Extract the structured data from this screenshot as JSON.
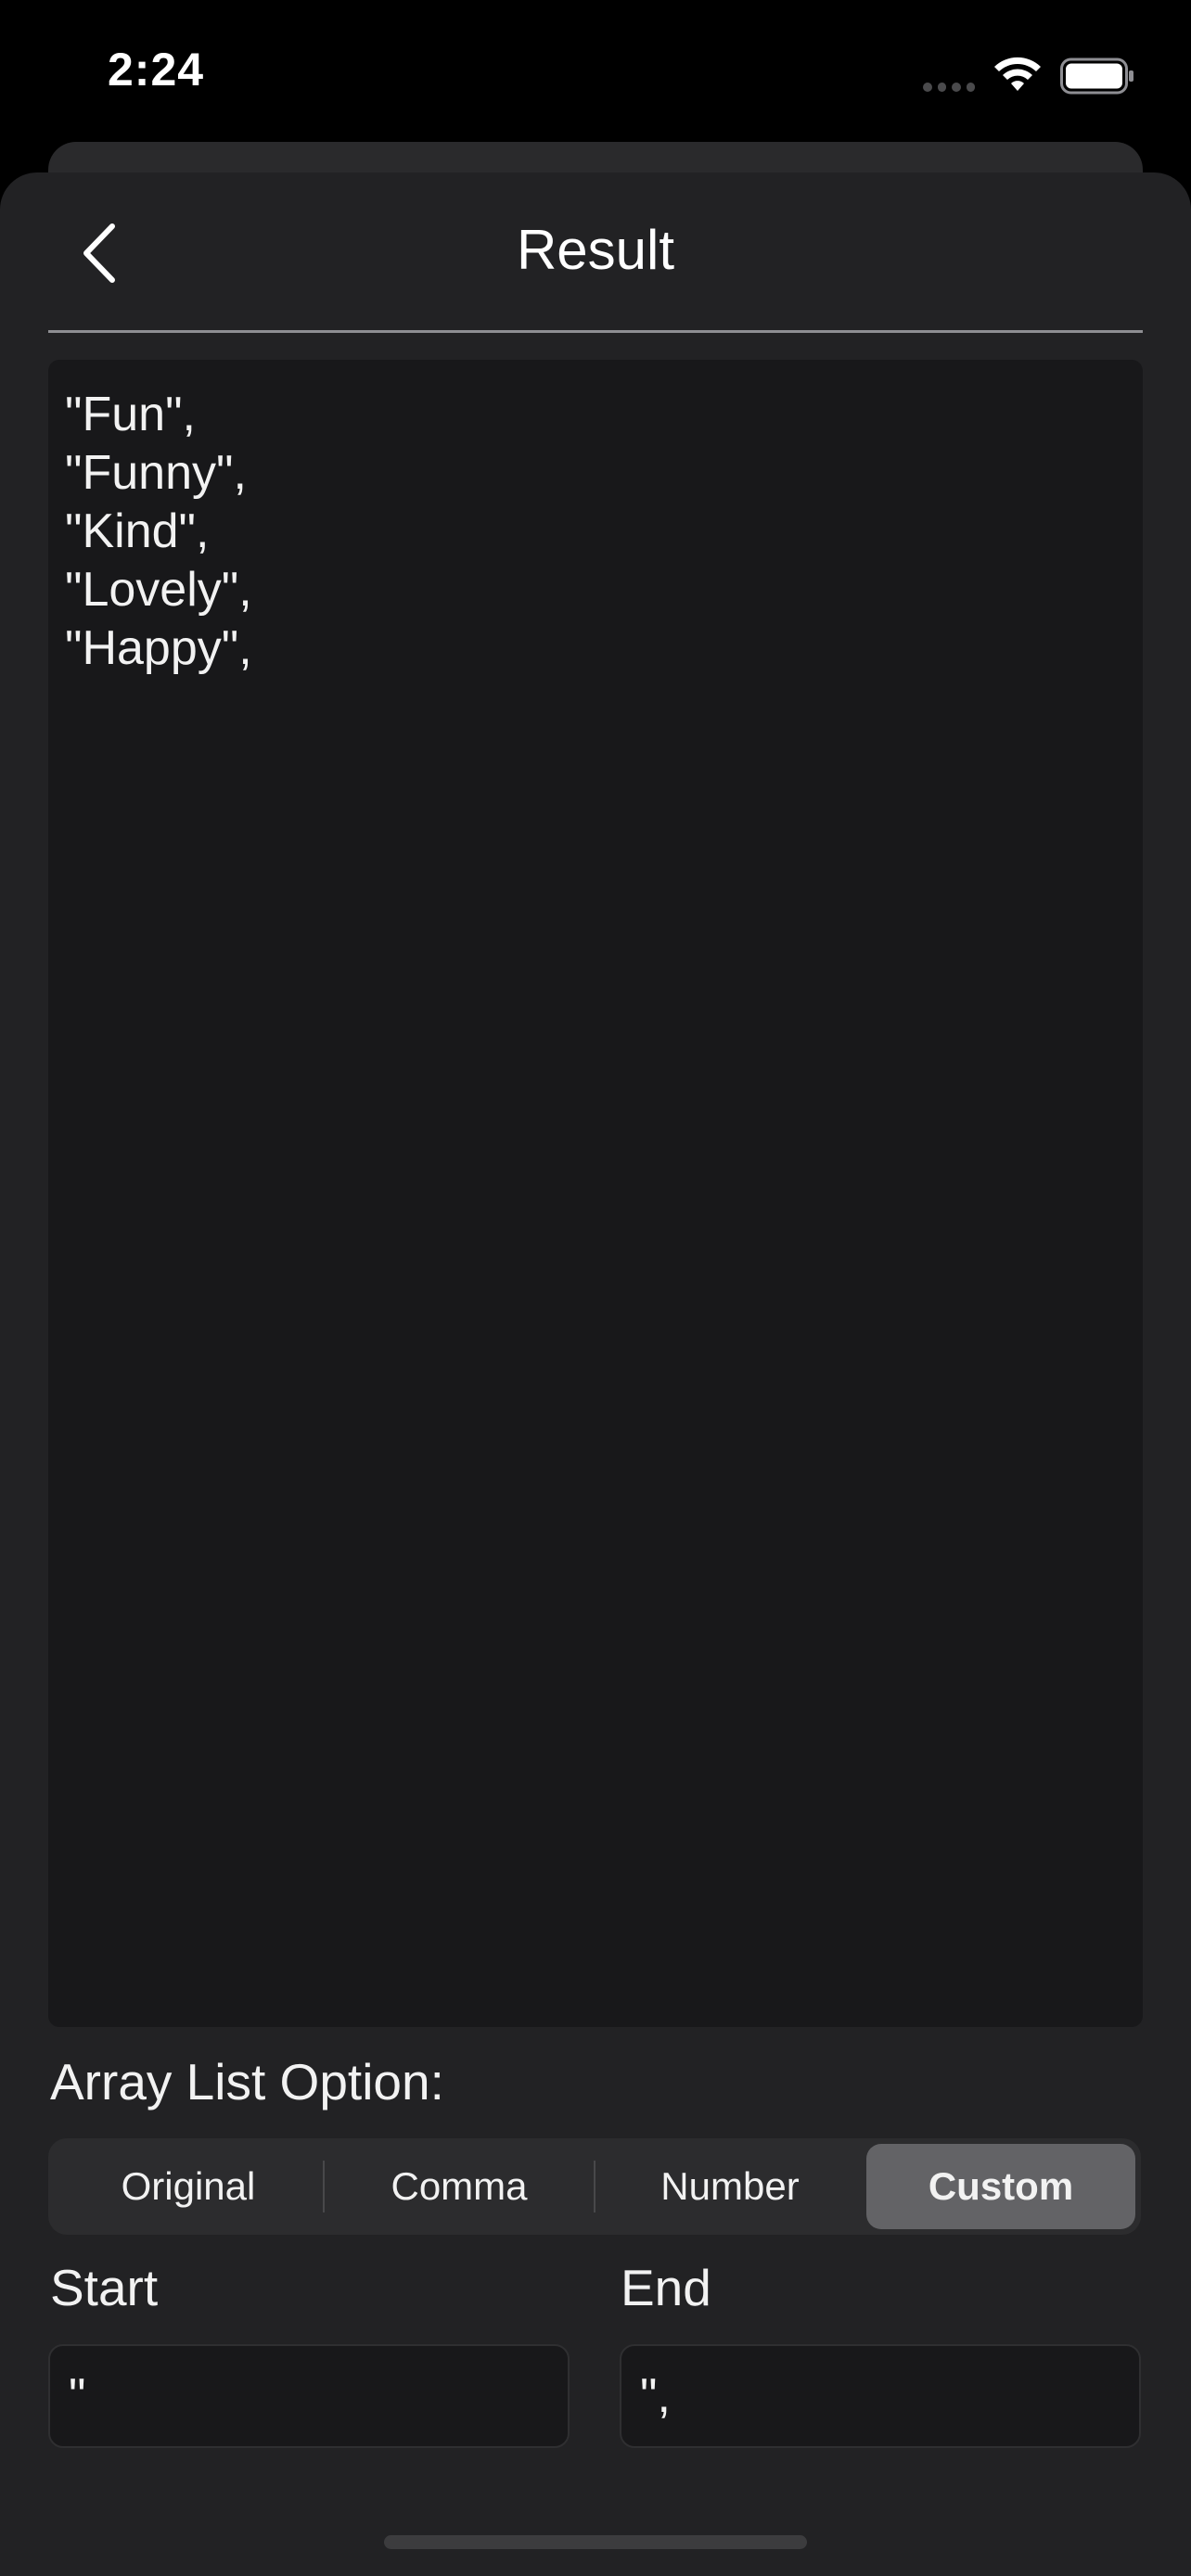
{
  "status_bar": {
    "time": "2:24"
  },
  "nav": {
    "title": "Result",
    "back_icon": "chevron-left-icon"
  },
  "result": {
    "lines": [
      "\"Fun\",",
      "\"Funny\",",
      "\"Kind\",",
      "\"Lovely\",",
      "\"Happy\","
    ]
  },
  "options": {
    "label": "Array List Option:",
    "segments": [
      "Original",
      "Comma",
      "Number",
      "Custom"
    ],
    "selected": "Custom"
  },
  "custom": {
    "start_label": "Start",
    "start_value": "\"",
    "end_label": "End",
    "end_value": "\","
  },
  "colors": {
    "background": "#000000",
    "sheet": "#222224",
    "text_area": "#18181a",
    "segment_selected": "#636366"
  }
}
